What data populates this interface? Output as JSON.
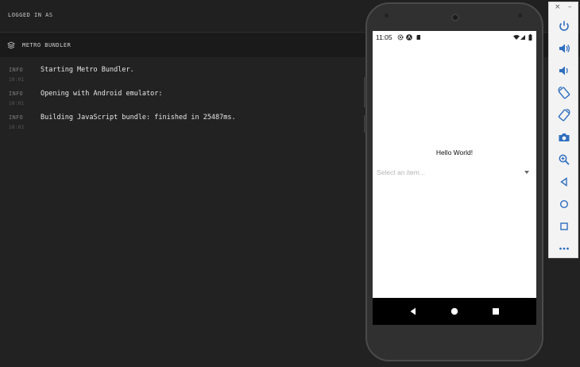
{
  "topbar": {
    "logged_in_label": "LOGGED IN AS"
  },
  "metro": {
    "section_title": "METRO BUNDLER"
  },
  "log_entries": [
    {
      "level": "INFO",
      "timestamp": "10:01",
      "message": "Starting Metro Bundler."
    },
    {
      "level": "INFO",
      "timestamp": "10:01",
      "message": "Opening with Android emulator:"
    },
    {
      "level": "INFO",
      "timestamp": "10:02",
      "message": "Building JavaScript bundle: finished in 25487ms."
    }
  ],
  "phone": {
    "status_time": "11:05",
    "status_icons_left": [
      "gear-icon",
      "app-logo-icon",
      "sd-card-icon"
    ],
    "status_icons_right": [
      "wifi-icon",
      "signal-icon",
      "battery-icon"
    ],
    "hello_text": "Hello World!",
    "picker_placeholder": "Select an item...",
    "nav_buttons": [
      "back-icon",
      "home-icon",
      "recents-icon"
    ]
  },
  "emulator_controls": {
    "window_buttons": {
      "close": "×",
      "minimize": "–"
    },
    "items": [
      "power-icon",
      "volume-up-icon",
      "volume-down-icon",
      "rotate-left-icon",
      "rotate-right-icon",
      "screenshot-icon",
      "zoom-icon",
      "back-icon",
      "home-icon",
      "overview-icon",
      "more-icon"
    ]
  },
  "colors": {
    "background": "#1f1f1f",
    "log_background": "#222222",
    "accent_icon": "#2f6fbf",
    "phone_body": "#303030"
  }
}
